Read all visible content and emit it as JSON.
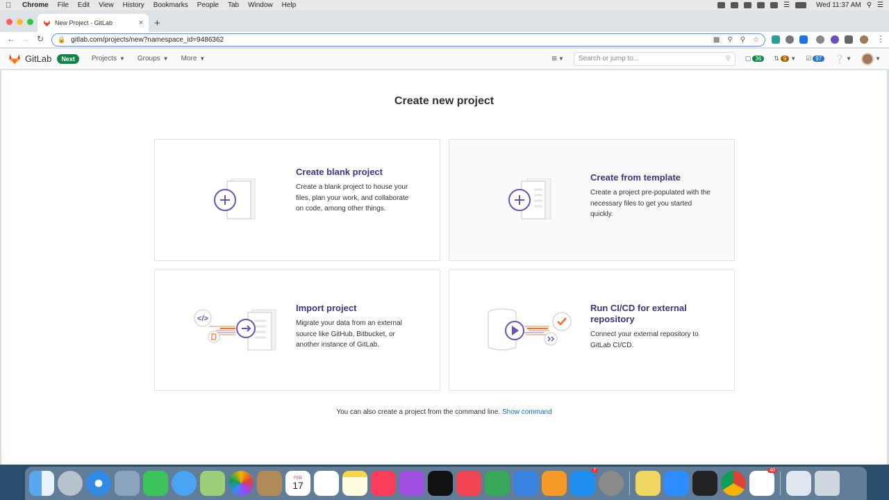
{
  "menubar": {
    "items": [
      "Chrome",
      "File",
      "Edit",
      "View",
      "History",
      "Bookmarks",
      "People",
      "Tab",
      "Window",
      "Help"
    ],
    "clock": "Wed 11:37 AM"
  },
  "browser": {
    "tab_title": "New Project · GitLab",
    "url": "gitlab.com/projects/new?namespace_id=9486362"
  },
  "header": {
    "brand": "GitLab",
    "next_badge": "Next",
    "nav": [
      "Projects",
      "Groups",
      "More"
    ],
    "search_placeholder": "Search or jump to...",
    "issues_count": "36",
    "mr_count": "9",
    "todo_count": "97"
  },
  "main": {
    "title": "Create new project",
    "cards": [
      {
        "title": "Create blank project",
        "description": "Create a blank project to house your files, plan your work, and collaborate on code, among other things."
      },
      {
        "title": "Create from template",
        "description": "Create a project pre-populated with the necessary files to get you started quickly."
      },
      {
        "title": "Import project",
        "description": "Migrate your data from an external source like GitHub, Bitbucket, or another instance of GitLab."
      },
      {
        "title": "Run CI/CD for external repository",
        "description": "Connect your external repository to GitLab CI/CD."
      }
    ],
    "footer_text": "You can also create a project from the command line.",
    "footer_link": "Show command"
  },
  "dock": {
    "calendar_month": "FEB",
    "calendar_day": "17",
    "appstore_badge": "7",
    "slack_badge": "40"
  },
  "colors": {
    "accent": "#6b4fbb",
    "card_title": "#3a3383",
    "link": "#1068bf",
    "next_badge": "#108548"
  }
}
